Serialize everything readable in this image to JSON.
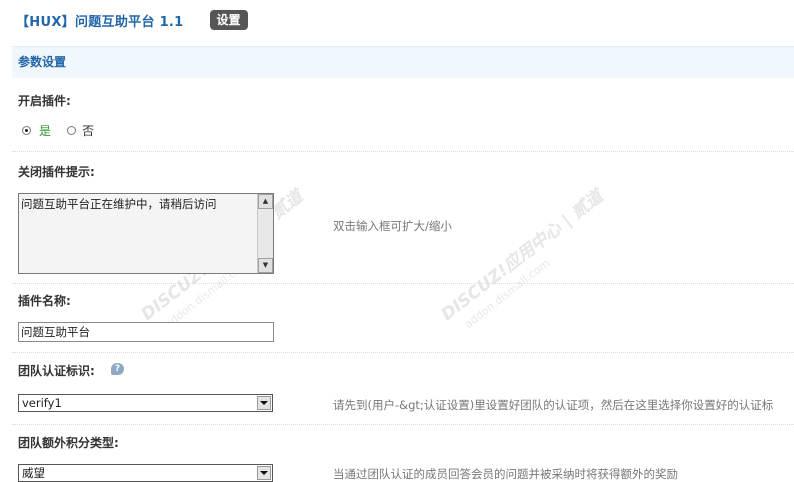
{
  "header": {
    "title": "【HUX】问题互助平台 1.1",
    "tab_label": "设置"
  },
  "section": {
    "title": "参数设置"
  },
  "fields": {
    "enable": {
      "label": "开启插件:",
      "options": [
        "是",
        "否"
      ],
      "selected": "是"
    },
    "close_tip": {
      "label": "关闭插件提示:",
      "value": "问题互助平台正在维护中，请稍后访问",
      "hint": "双击输入框可扩大/缩小"
    },
    "plugin_name": {
      "label": "插件名称:",
      "value": "问题互助平台"
    },
    "team_verify": {
      "label": "团队认证标识:",
      "value": "verify1",
      "hint": "请先到(用户-&gt;认证设置)里设置好团队的认证项，然后在这里选择你设置好的认证标"
    },
    "team_credit": {
      "label": "团队额外积分类型:",
      "value": "威望",
      "hint": "当通过团队认证的成员回答会员的问题并被采纳时将获得额外的奖励"
    }
  },
  "watermark": {
    "brand": "DISCUZ!应用中心 | 贰道",
    "url": "addon.dismall.com"
  },
  "icons": {
    "help": "help-bubble-icon",
    "scroll_up": "scroll-up-icon",
    "scroll_down": "scroll-down-icon",
    "dropdown": "chevron-down-icon"
  },
  "colors": {
    "title": "#2366a8",
    "section_bg": "#f0f7fd",
    "yes_label": "#2a9a2a",
    "tab_bg": "#555555"
  }
}
